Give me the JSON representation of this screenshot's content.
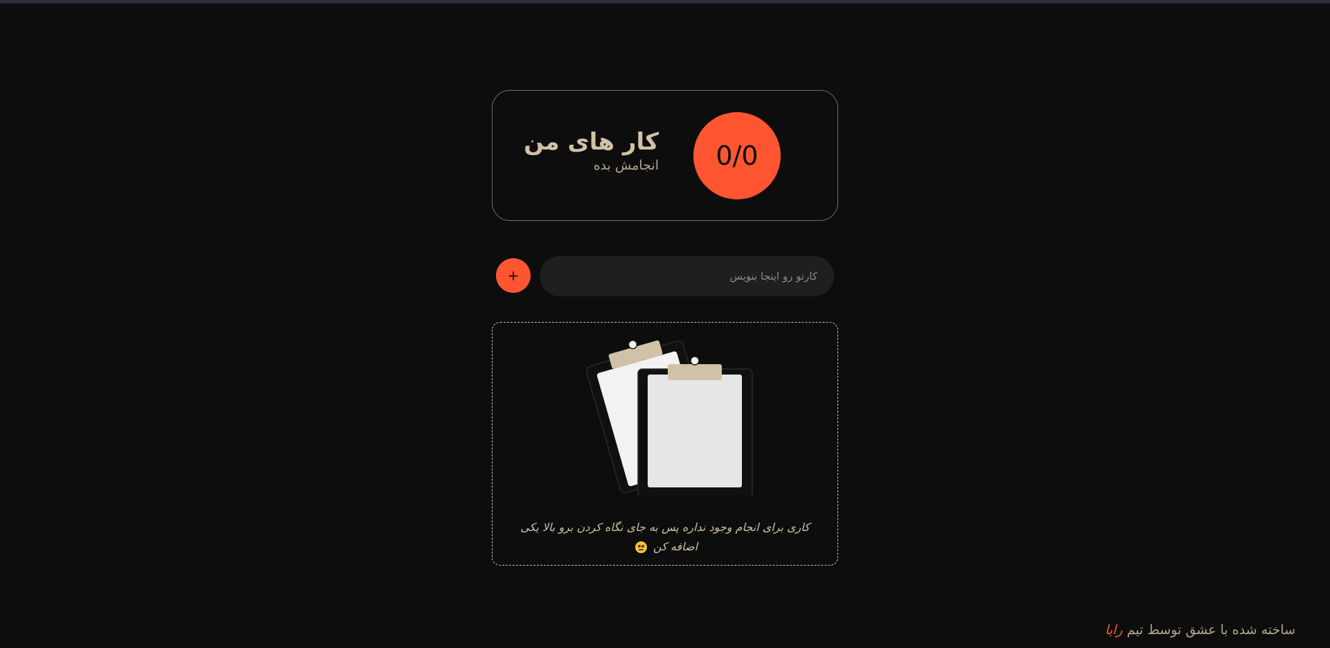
{
  "colors": {
    "background": "#0d0d0d",
    "accent": "#ff5631",
    "text": "#d1c1a6",
    "input_background": "#1e1f1f",
    "card_border": "#6b6b6b"
  },
  "summary": {
    "title": "کار های من",
    "subtitle": "انجامش بده",
    "progress_text": "0/0",
    "completed": 0,
    "total": 0
  },
  "add_task": {
    "button_label": "+",
    "input_placeholder": "کارتو رو اینجا بنویس",
    "input_value": ""
  },
  "empty_state": {
    "illustration_icon": "clipboards-icon",
    "message": "کاری برای انجام وجود نداره پس به جای نگاه کردن برو بالا یکی اضافه کن",
    "emoji_icon": "grimacing-face-icon"
  },
  "footer": {
    "text": "ساخته شده با عشق توسط تیم",
    "team_name": "رایا"
  }
}
